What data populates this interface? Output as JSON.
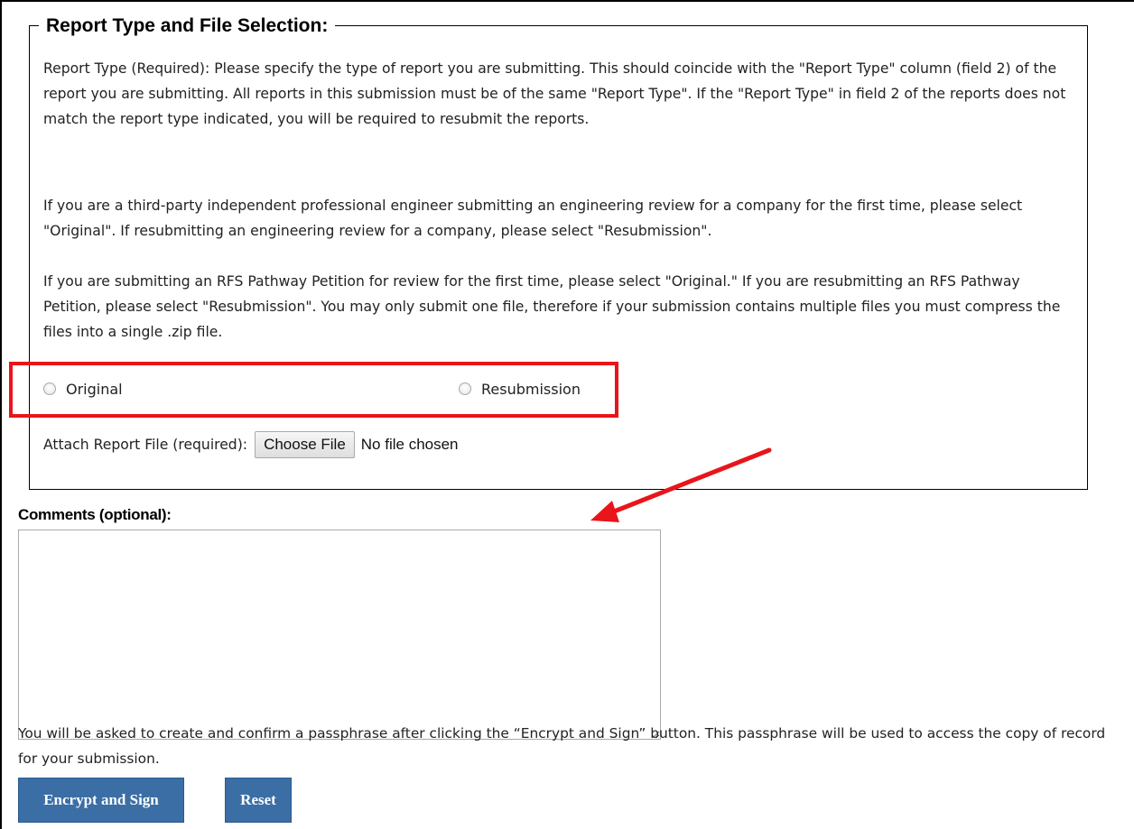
{
  "fieldset": {
    "legend": "Report Type and File Selection:",
    "paragraphs": [
      "Report Type (Required): Please specify the type of report you are submitting. This should coincide with the \"Report Type\" column (field 2) of the report you are submitting. All reports in this submission must be of the same \"Report Type\". If the \"Report Type\" in field 2 of the reports does not match the report type indicated, you will be required to resubmit the reports.",
      "If you are a third-party independent professional engineer submitting an engineering review for a company for the first time, please select \"Original\". If resubmitting an engineering review for a company, please select \"Resubmission\".",
      "If you are submitting an RFS Pathway Petition for review for the first time, please select \"Original.\" If you are resubmitting an RFS Pathway Petition, please select \"Resubmission\". You may only submit one file, therefore if your submission contains multiple files you must compress the files into a single .zip file."
    ],
    "radio_options": [
      {
        "label": "Original",
        "selected": false
      },
      {
        "label": "Resubmission",
        "selected": false
      }
    ],
    "attach_label": "Attach Report File (required):",
    "choose_button": "Choose File",
    "file_status": "No file chosen"
  },
  "comments": {
    "label": "Comments (optional):",
    "value": ""
  },
  "passphrase_note": "You will be asked to create and confirm a passphrase after clicking the “Encrypt and Sign” button. This passphrase will be used to access the copy of record for your submission.",
  "buttons": {
    "encrypt": "Encrypt and Sign",
    "reset": "Reset"
  },
  "colors": {
    "highlight": "#e8151b",
    "button_blue": "#3b6ea5"
  }
}
